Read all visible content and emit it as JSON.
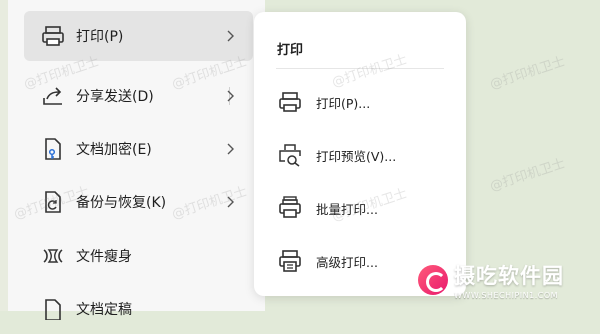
{
  "menu": {
    "items": [
      {
        "label": "打印(P)",
        "icon": "printer-icon"
      },
      {
        "label": "分享发送(D)",
        "icon": "share-icon"
      },
      {
        "label": "文档加密(E)",
        "icon": "doc-key-icon"
      },
      {
        "label": "备份与恢复(K)",
        "icon": "backup-icon"
      },
      {
        "label": "文件瘦身",
        "icon": "slim-icon"
      },
      {
        "label": "文档定稿",
        "icon": "finalize-icon"
      }
    ]
  },
  "submenu": {
    "title": "打印",
    "items": [
      {
        "label": "打印(P)...",
        "icon": "printer-icon"
      },
      {
        "label": "打印预览(V)...",
        "icon": "print-preview-icon"
      },
      {
        "label": "批量打印...",
        "icon": "batch-print-icon"
      },
      {
        "label": "高级打印...",
        "icon": "advanced-print-icon"
      }
    ]
  },
  "watermark": "@打印机卫士",
  "brand": {
    "name": "摄吃软件园",
    "url": "WWW.SHECHIPIN1.COM",
    "accent": "#e8196d"
  }
}
